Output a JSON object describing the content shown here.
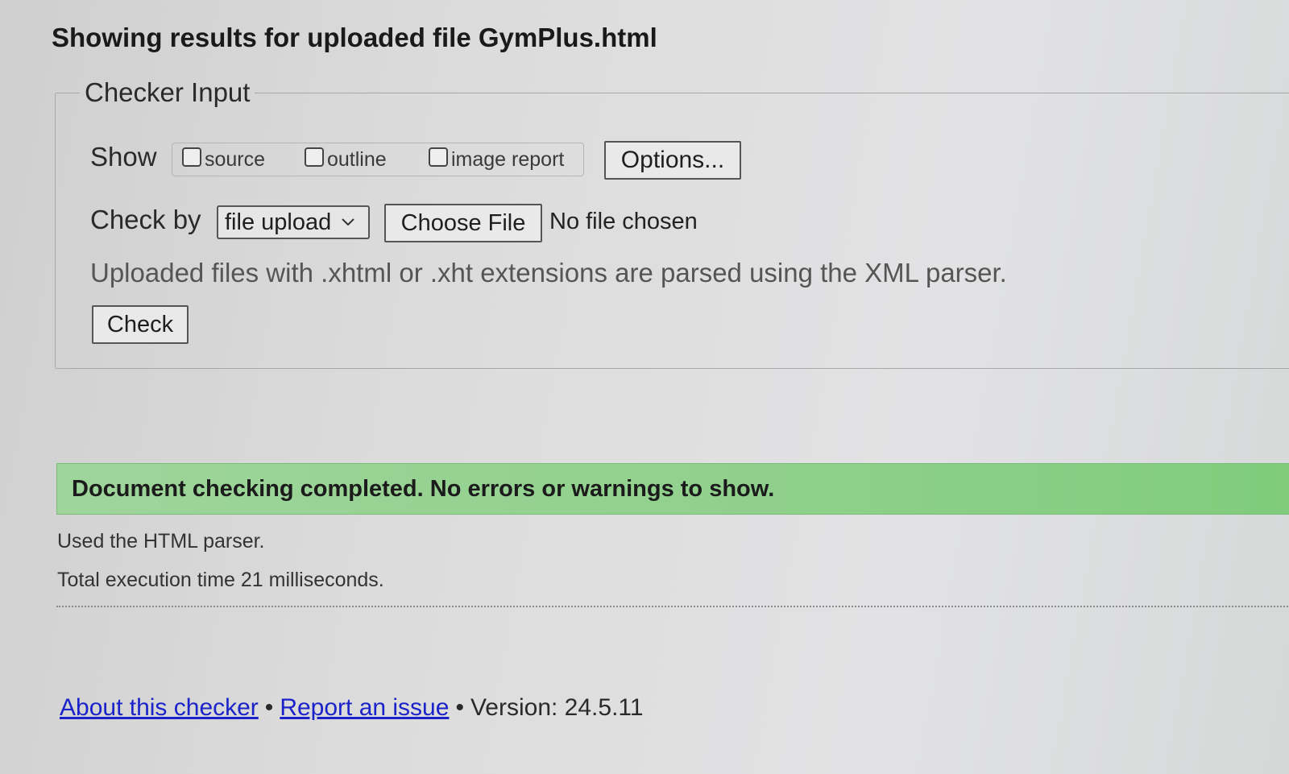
{
  "page": {
    "title": "Showing results for uploaded file GymPlus.html"
  },
  "checker_input": {
    "legend": "Checker Input",
    "show_label": "Show",
    "checkboxes": [
      {
        "label": "source",
        "checked": false
      },
      {
        "label": "outline",
        "checked": false
      },
      {
        "label": "image report",
        "checked": false
      }
    ],
    "options_button": "Options...",
    "check_by_label": "Check by",
    "check_by_select": "file upload",
    "choose_file_button": "Choose File",
    "file_status": "No file chosen",
    "note": "Uploaded files with .xhtml or .xht extensions are parsed using the XML parser.",
    "check_button": "Check"
  },
  "results": {
    "success_message": "Document checking completed. No errors or warnings to show.",
    "parser_info": "Used the HTML parser.",
    "execution_time": "Total execution time 21 milliseconds."
  },
  "footer": {
    "about_link": "About this checker",
    "separator": "•",
    "report_link": "Report an issue",
    "version": "Version: 24.5.11"
  },
  "colors": {
    "success_bg": "#8fd08b",
    "link": "#1a23c9"
  }
}
